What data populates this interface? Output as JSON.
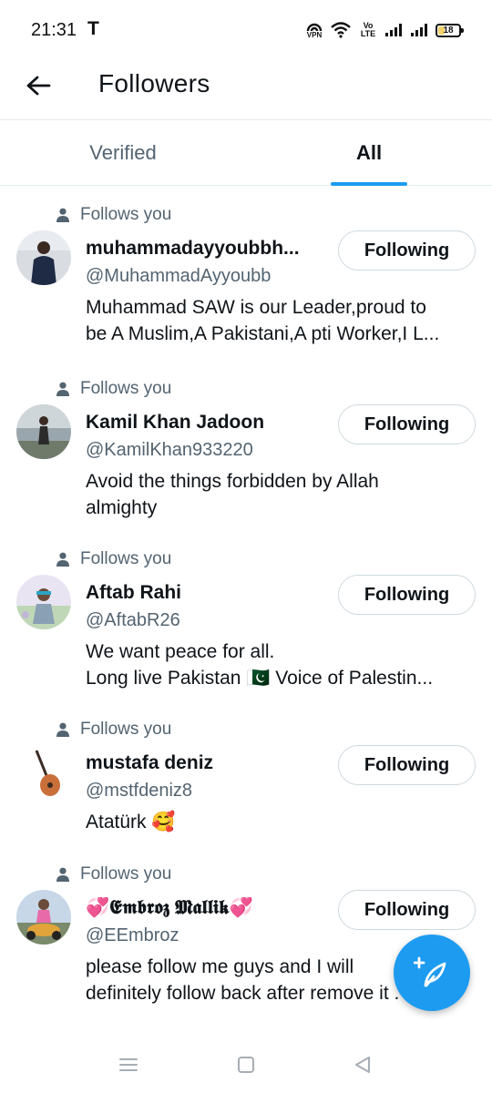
{
  "status_bar": {
    "time": "21:31",
    "carrier_icon": "T",
    "vpn_label": "VPN",
    "volte_label": "Vo LTE",
    "battery_percent": "18"
  },
  "header": {
    "title": "Followers",
    "back_icon": "arrow-left-icon"
  },
  "tabs": [
    {
      "label": "Verified",
      "selected": false
    },
    {
      "label": "All",
      "selected": true
    }
  ],
  "followers": [
    {
      "follows_you": "Follows you",
      "name": "muhammadayyoubbh...",
      "handle": "@MuhammadAyyoubb",
      "bio_lines": [
        "Muhammad SAW is our Leader,proud to",
        "be A Muslim,A Pakistani,A pti Worker,I L..."
      ],
      "button": "Following"
    },
    {
      "follows_you": "Follows you",
      "name": "Kamil Khan Jadoon",
      "handle": "@KamilKhan933220",
      "bio_lines": [
        "Avoid the things forbidden by Allah",
        "almighty"
      ],
      "button": "Following"
    },
    {
      "follows_you": "Follows you",
      "name": "Aftab Rahi",
      "handle": "@AftabR26",
      "bio_lines": [
        "We want peace for all.",
        "Long live Pakistan  🇵🇰 Voice of Palestin..."
      ],
      "button": "Following"
    },
    {
      "follows_you": "Follows you",
      "name": "mustafa deniz",
      "handle": "@mstfdeniz8",
      "bio_lines": [
        "Atatürk 🥰"
      ],
      "button": "Following"
    },
    {
      "follows_you": "Follows you",
      "name": "💞𝕰𝖒𝖇𝖗𝖔𝖟 𝕸𝖆𝖑𝖑𝖎𝖐💞",
      "handle": "@EEmbroz",
      "bio_lines": [
        "please follow me guys and I will",
        "definitely follow back after remove it ."
      ],
      "button": "Following"
    }
  ],
  "fab": {
    "icon": "compose-post-icon"
  },
  "colors": {
    "accent": "#1d9bf0",
    "text_primary": "#0f1419",
    "text_secondary": "#536471",
    "border": "#cfd9de"
  }
}
